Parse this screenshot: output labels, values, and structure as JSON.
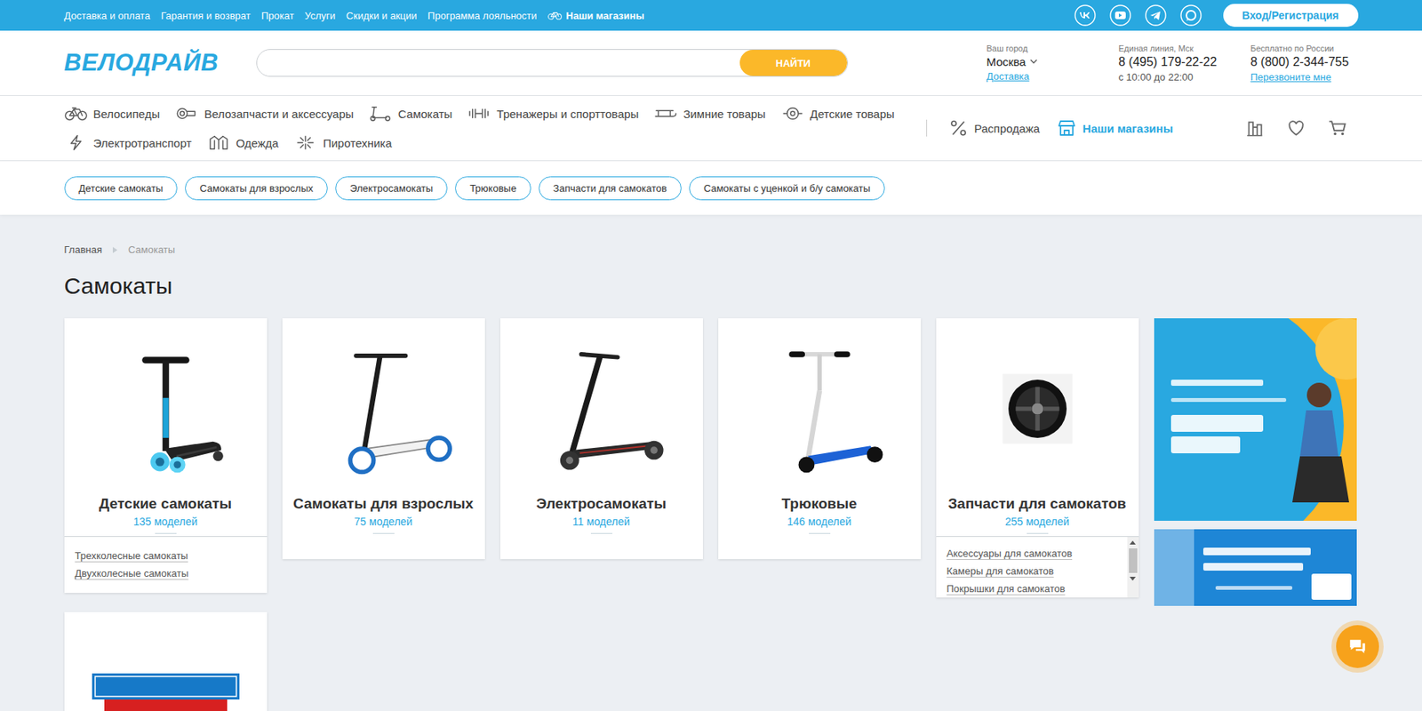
{
  "topbar": {
    "links": [
      "Доставка и оплата",
      "Гарантия и возврат",
      "Прокат",
      "Услуги",
      "Скидки и акции",
      "Программа лояльности"
    ],
    "stores": "Наши магазины",
    "login": "Вход/Регистрация"
  },
  "header": {
    "logo": "ВЕЛОДРАЙВ",
    "search_button": "НАЙТИ",
    "city": {
      "label": "Ваш город",
      "value": "Москва",
      "link": "Доставка"
    },
    "phones": [
      {
        "label": "Единая линия, Мск",
        "number": "8 (495) 179-22-22",
        "sub": "с 10:00 до 22:00",
        "kind": "note"
      },
      {
        "label": "Бесплатно по России",
        "number": "8 (800) 2-344-755",
        "sub": "Перезвоните мне",
        "kind": "link"
      }
    ]
  },
  "nav": {
    "rows": [
      [
        "Велосипеды",
        "Велозапчасти и аксессуары",
        "Самокаты",
        "Тренажеры и спорттовары",
        "Зимние товары",
        "Детские товары"
      ],
      [
        "Электротранспорт",
        "Одежда",
        "Пиротехника"
      ]
    ],
    "extra": [
      {
        "label": "Распродажа",
        "selected": false
      },
      {
        "label": "Наши магазины",
        "selected": true
      }
    ]
  },
  "subcategories": [
    "Детские самокаты",
    "Самокаты для взрослых",
    "Электросамокаты",
    "Трюковые",
    "Запчасти для самокатов",
    "Самокаты с уценкой и б/у самокаты"
  ],
  "breadcrumbs": [
    "Главная",
    "Самокаты"
  ],
  "title": "Самокаты",
  "cards": [
    {
      "title": "Детские самокаты",
      "count": "135 моделей",
      "links": [
        "Трехколесные самокаты",
        "Двухколесные самокаты"
      ],
      "scrollable": false
    },
    {
      "title": "Самокаты для взрослых",
      "count": "75 моделей",
      "links": [],
      "scrollable": false
    },
    {
      "title": "Электросамокаты",
      "count": "11 моделей",
      "links": [],
      "scrollable": false
    },
    {
      "title": "Трюковые",
      "count": "146 моделей",
      "links": [],
      "scrollable": false
    },
    {
      "title": "Запчасти для самокатов",
      "count": "255 моделей",
      "links": [
        "Аксессуары для самокатов",
        "Камеры для самокатов",
        "Покрышки для самокатов"
      ],
      "scrollable": true
    }
  ]
}
